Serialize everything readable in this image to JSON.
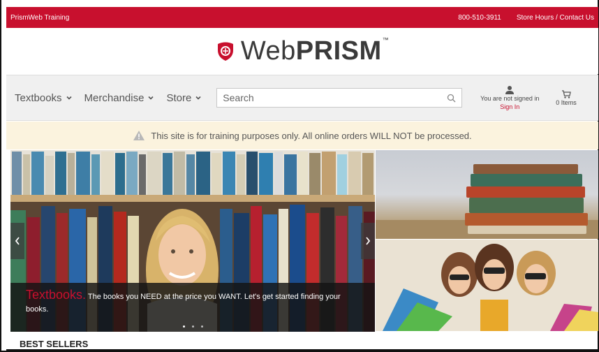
{
  "topbar": {
    "site_name": "PrismWeb Training",
    "phone": "800-510-3911",
    "hours_link": "Store Hours / Contact Us",
    "bg_color": "#c8102e"
  },
  "logo": {
    "text_web": "Web",
    "text_prism": "PRISM",
    "trademark": "™"
  },
  "nav": {
    "items": [
      {
        "label": "Textbooks",
        "icon": "chevron-down-icon"
      },
      {
        "label": "Merchandise",
        "icon": "chevron-down-icon"
      },
      {
        "label": "Store",
        "icon": "chevron-down-icon"
      }
    ],
    "search_placeholder": "Search",
    "account_status": "You are not signed in",
    "sign_in": "Sign In",
    "cart_label": "0 Items"
  },
  "notice": {
    "text": "This site is for training purposes only. All online orders WILL NOT be processed.",
    "icon": "warning-icon"
  },
  "hero": {
    "highlight": "Textbooks.",
    "caption": " The books you NEED at the price you WANT. Let's get started finding your books.",
    "slide_count": 3,
    "active_slide": 1
  },
  "section": {
    "best_sellers": "BEST SELLERS"
  },
  "colors": {
    "accent": "#c8102e",
    "notice_bg": "#fbf3de",
    "nav_bg": "#f0f0f0"
  }
}
